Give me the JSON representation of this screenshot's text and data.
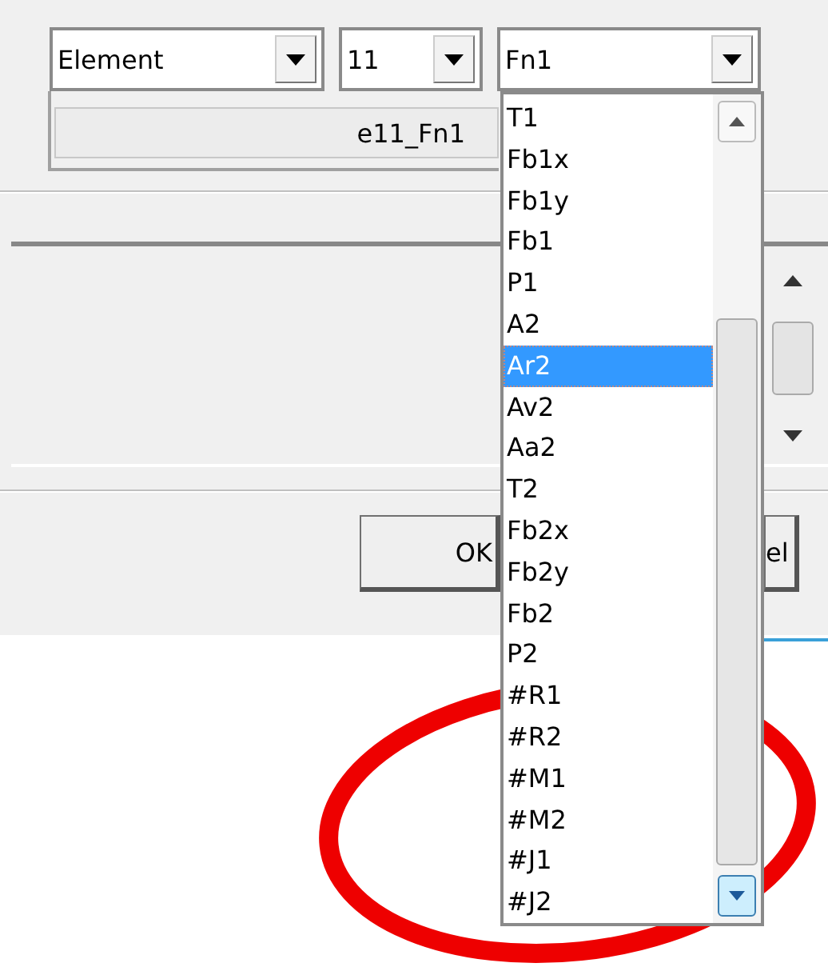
{
  "combos": [
    {
      "value": "Element"
    },
    {
      "value": "11"
    },
    {
      "value": "Fn1",
      "expanded": true
    }
  ],
  "name_field": {
    "value": "e11_Fn1"
  },
  "dropdown": {
    "items": [
      {
        "label": "T1",
        "selected": false
      },
      {
        "label": "Fb1x",
        "selected": false
      },
      {
        "label": "Fb1y",
        "selected": false
      },
      {
        "label": "Fb1",
        "selected": false
      },
      {
        "label": "P1",
        "selected": false
      },
      {
        "label": "A2",
        "selected": false
      },
      {
        "label": "Ar2",
        "selected": true
      },
      {
        "label": "Av2",
        "selected": false
      },
      {
        "label": "Aa2",
        "selected": false
      },
      {
        "label": "T2",
        "selected": false
      },
      {
        "label": "Fb2x",
        "selected": false
      },
      {
        "label": "Fb2y",
        "selected": false
      },
      {
        "label": "Fb2",
        "selected": false
      },
      {
        "label": "P2",
        "selected": false
      },
      {
        "label": "#R1",
        "selected": false
      },
      {
        "label": "#R2",
        "selected": false
      },
      {
        "label": "#M1",
        "selected": false
      },
      {
        "label": "#M2",
        "selected": false
      },
      {
        "label": "#J1",
        "selected": false
      },
      {
        "label": "#J2",
        "selected": false
      }
    ]
  },
  "buttons": [
    {
      "label": "OK"
    },
    {
      "label": "el"
    }
  ]
}
